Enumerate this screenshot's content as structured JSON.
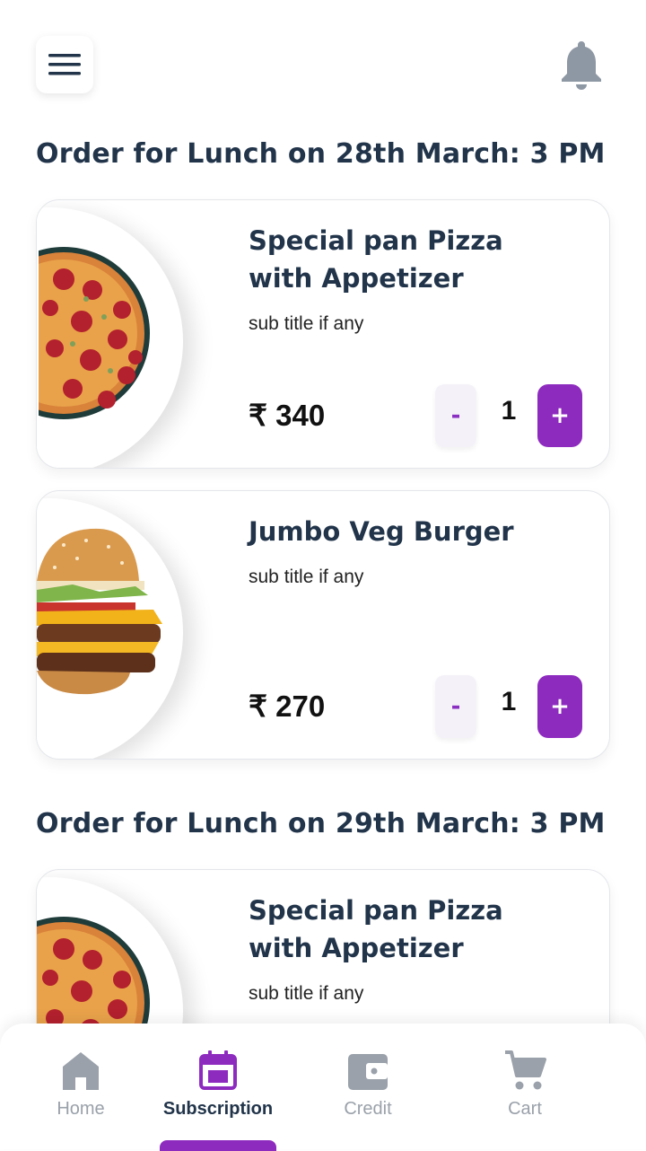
{
  "header": {
    "menu_icon": "hamburger-menu-icon",
    "notification_icon": "bell-icon"
  },
  "sections": [
    {
      "title": "Order for Lunch on 28th March: 3 PM",
      "items": [
        {
          "name": "Special pan Pizza with Appetizer",
          "subtitle": "sub title if any",
          "price": "₹ 340",
          "qty": "1",
          "minus": "-",
          "plus": "+",
          "image": "pizza-image"
        },
        {
          "name": "Jumbo Veg Burger",
          "subtitle": "sub title if any",
          "price": "₹ 270",
          "qty": "1",
          "minus": "-",
          "plus": "+",
          "image": "burger-image"
        }
      ]
    },
    {
      "title": "Order for Lunch on 29th March: 3 PM",
      "items": [
        {
          "name": "Special pan Pizza with Appetizer",
          "subtitle": "sub title if any",
          "image": "pizza-image"
        }
      ]
    }
  ],
  "bottom_nav": {
    "items": [
      {
        "label": "Home",
        "icon": "home-icon",
        "active": false
      },
      {
        "label": "Subscription",
        "icon": "calendar-icon",
        "active": true
      },
      {
        "label": "Credit",
        "icon": "wallet-icon",
        "active": false
      },
      {
        "label": "Cart",
        "icon": "cart-icon",
        "active": false
      }
    ]
  },
  "colors": {
    "accent": "#8e2bbf",
    "heading": "#21344a",
    "inactive": "#9aa1aa"
  }
}
